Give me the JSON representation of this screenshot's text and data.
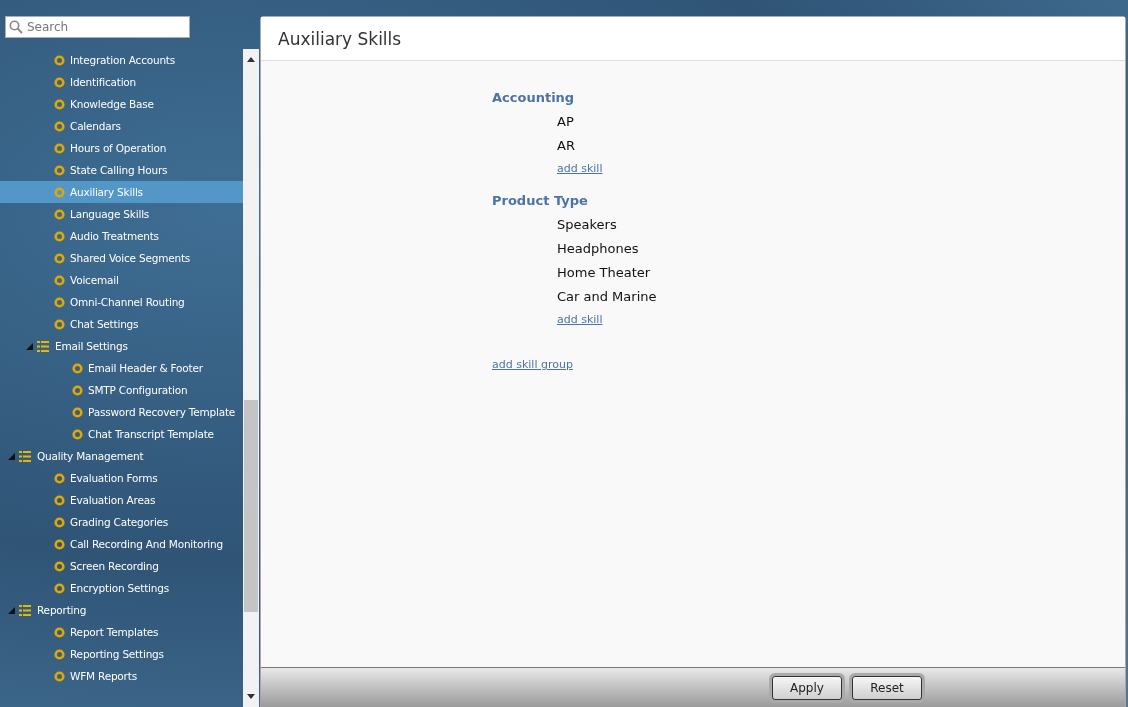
{
  "search": {
    "placeholder": "Search"
  },
  "tree": [
    {
      "children": [
        {
          "label": "Integration Accounts",
          "selected": false
        },
        {
          "label": "Identification",
          "selected": false
        },
        {
          "label": "Knowledge Base",
          "selected": false
        },
        {
          "label": "Calendars",
          "selected": false
        },
        {
          "label": "Hours of Operation",
          "selected": false
        },
        {
          "label": "State Calling Hours",
          "selected": false
        },
        {
          "label": "Auxiliary Skills",
          "selected": true
        },
        {
          "label": "Language Skills",
          "selected": false
        },
        {
          "label": "Audio Treatments",
          "selected": false
        },
        {
          "label": "Shared Voice Segments",
          "selected": false
        },
        {
          "label": "Voicemail",
          "selected": false
        },
        {
          "label": "Omni-Channel Routing",
          "selected": false
        },
        {
          "label": "Chat Settings",
          "selected": false
        },
        {
          "label": "Email Settings",
          "selected": false,
          "expanded": true,
          "children": [
            {
              "label": "Email Header & Footer",
              "selected": false
            },
            {
              "label": "SMTP Configuration",
              "selected": false
            },
            {
              "label": "Password Recovery Template",
              "selected": false
            },
            {
              "label": "Chat Transcript Template",
              "selected": false
            }
          ]
        }
      ]
    },
    {
      "label": "Quality Management",
      "selected": false,
      "expanded": true,
      "children": [
        {
          "label": "Evaluation Forms",
          "selected": false
        },
        {
          "label": "Evaluation Areas",
          "selected": false
        },
        {
          "label": "Grading Categories",
          "selected": false
        },
        {
          "label": "Call Recording And Monitoring",
          "selected": false
        },
        {
          "label": "Screen Recording",
          "selected": false
        },
        {
          "label": "Encryption Settings",
          "selected": false
        }
      ]
    },
    {
      "label": "Reporting",
      "selected": false,
      "expanded": true,
      "children": [
        {
          "label": "Report Templates",
          "selected": false
        },
        {
          "label": "Reporting Settings",
          "selected": false
        },
        {
          "label": "WFM Reports",
          "selected": false
        }
      ]
    }
  ],
  "panel": {
    "title": "Auxiliary Skills",
    "groups": [
      {
        "name": "Accounting",
        "skills": [
          "AP",
          "AR"
        ],
        "add_link": "add skill"
      },
      {
        "name": "Product Type",
        "skills": [
          "Speakers",
          "Headphones",
          "Home Theater",
          "Car and Marine"
        ],
        "add_link": "add skill"
      }
    ],
    "add_group_link": "add skill group",
    "buttons": [
      "Apply",
      "Reset"
    ]
  }
}
